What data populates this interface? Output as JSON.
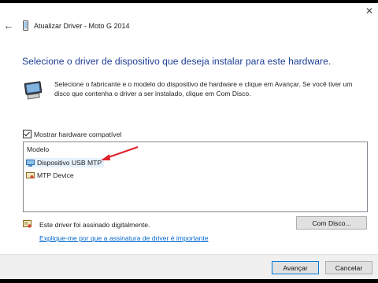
{
  "window": {
    "title": "Atualizar Driver - Moto G 2014",
    "back_glyph": "←",
    "close_glyph": "✕"
  },
  "heading": "Selecione o driver de dispositivo que deseja instalar para este hardware.",
  "description": "Selecione o fabricante e o modelo do dispositivo de hardware e clique em Avançar. Se você tiver um disco que contenha o driver a ser instalado, clique em Com Disco.",
  "compat_checkbox": {
    "label": "Mostrar hardware compatível",
    "checked": true
  },
  "model_list": {
    "header": "Modelo",
    "items": [
      {
        "label": "Dispositivo USB MTP",
        "selected": true,
        "icon": "usb-device-icon"
      },
      {
        "label": "MTP Device",
        "selected": false,
        "icon": "certified-driver-icon"
      }
    ]
  },
  "signature": {
    "text": "Este driver foi assinado digitalmente.",
    "link": "Explique-me por que a assinatura de driver é importante",
    "icon": "signed-driver-icon"
  },
  "buttons": {
    "have_disk": "Com Disco...",
    "next": "Avançar",
    "cancel": "Cancelar"
  },
  "colors": {
    "heading": "#1e3f96",
    "link": "#0066cc",
    "selection": "#e5f1fb",
    "annotation_arrow": "#e0202a",
    "primary_border": "#0078d7"
  }
}
